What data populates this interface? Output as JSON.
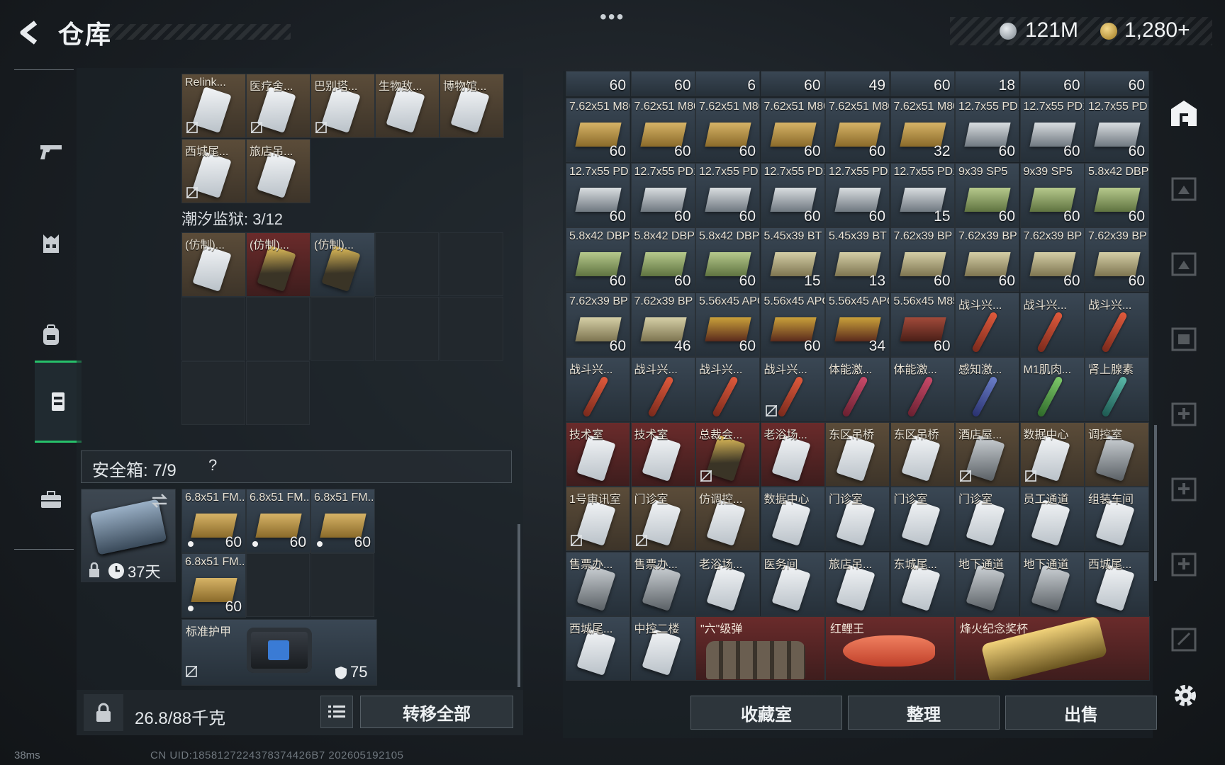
{
  "header": {
    "title": "仓库",
    "currency_silver": "121M",
    "currency_gold": "1,280+"
  },
  "nav": {
    "items": [
      "weapon",
      "vest",
      "backpack",
      "storage",
      "case"
    ]
  },
  "left": {
    "row1": [
      {
        "label": "Relink...",
        "type": "keycard",
        "color": "tan",
        "nobind": true
      },
      {
        "label": "医疗舍...",
        "type": "keycard",
        "color": "tan",
        "nobind": true
      },
      {
        "label": "巴别塔...",
        "type": "keycard",
        "color": "tan",
        "nobind": true
      },
      {
        "label": "生物敌...",
        "type": "keycard",
        "color": "tan"
      },
      {
        "label": "博物馆...",
        "type": "keycard",
        "color": "tan"
      }
    ],
    "row2": [
      {
        "label": "西城尾...",
        "type": "keycard",
        "color": "tan",
        "nobind": true
      },
      {
        "label": "旅店吊...",
        "type": "keycard",
        "color": "tan"
      }
    ],
    "prison_label": "潮汐监狱: 3/12",
    "prison": [
      {
        "label": "(仿制)...",
        "type": "keycard",
        "color": "tan"
      },
      {
        "label": "(仿制)...",
        "type": "keycard",
        "color": "red",
        "variant": "gold"
      },
      {
        "label": "(仿制)...",
        "type": "keycard",
        "color": "blue",
        "variant": "gold"
      }
    ],
    "safe_label": "安全箱: 7/9",
    "safe_help": "?",
    "safe_days": "37天",
    "safe_items": [
      {
        "label": "6.8x51 FM...",
        "count": "60"
      },
      {
        "label": "6.8x51 FM...",
        "count": "60"
      },
      {
        "label": "6.8x51 FM...",
        "count": "60"
      },
      {
        "label": "6.8x51 FM...",
        "count": "60"
      }
    ],
    "armor_label": "标准护甲",
    "armor_value": "75",
    "weight": "26.8/88千克",
    "transfer_all": "转移全部"
  },
  "right": {
    "top_counts": [
      "60",
      "60",
      "6",
      "60",
      "49",
      "60",
      "18",
      "60",
      "60"
    ],
    "rows": [
      [
        {
          "label": "7.62x51 M80",
          "count": "60",
          "type": "ammo",
          "color": "blue",
          "box": "gold"
        },
        {
          "label": "7.62x51 M80",
          "count": "60",
          "type": "ammo",
          "color": "blue",
          "box": "gold"
        },
        {
          "label": "7.62x51 M80",
          "count": "60",
          "type": "ammo",
          "color": "blue",
          "box": "gold"
        },
        {
          "label": "7.62x51 M80",
          "count": "60",
          "type": "ammo",
          "color": "blue",
          "box": "gold"
        },
        {
          "label": "7.62x51 M80",
          "count": "60",
          "type": "ammo",
          "color": "blue",
          "box": "gold"
        },
        {
          "label": "7.62x51 M80",
          "count": "32",
          "type": "ammo",
          "color": "blue",
          "box": "gold"
        },
        {
          "label": "12.7x55 PD12",
          "count": "60",
          "type": "ammo",
          "color": "blue",
          "box": "silver"
        },
        {
          "label": "12.7x55 PD12",
          "count": "60",
          "type": "ammo",
          "color": "blue",
          "box": "silver"
        },
        {
          "label": "12.7x55 PD12",
          "count": "60",
          "type": "ammo",
          "color": "blue",
          "box": "silver"
        }
      ],
      [
        {
          "label": "12.7x55 PD12",
          "count": "60",
          "type": "ammo",
          "color": "blue",
          "box": "silver"
        },
        {
          "label": "12.7x55 PD12",
          "count": "60",
          "type": "ammo",
          "color": "blue",
          "box": "silver"
        },
        {
          "label": "12.7x55 PD12",
          "count": "60",
          "type": "ammo",
          "color": "blue",
          "box": "silver"
        },
        {
          "label": "12.7x55 PD12",
          "count": "60",
          "type": "ammo",
          "color": "blue",
          "box": "silver"
        },
        {
          "label": "12.7x55 PD12",
          "count": "60",
          "type": "ammo",
          "color": "blue",
          "box": "silver"
        },
        {
          "label": "12.7x55 PD12",
          "count": "15",
          "type": "ammo",
          "color": "blue",
          "box": "silver"
        },
        {
          "label": "9x39 SP5",
          "count": "60",
          "type": "ammo",
          "color": "blue",
          "box": "green"
        },
        {
          "label": "9x39 SP5",
          "count": "60",
          "type": "ammo",
          "color": "blue",
          "box": "green"
        },
        {
          "label": "5.8x42 DBP10",
          "count": "60",
          "type": "ammo",
          "color": "blue",
          "box": "green"
        }
      ],
      [
        {
          "label": "5.8x42 DBP10",
          "count": "60",
          "type": "ammo",
          "color": "blue",
          "box": "green"
        },
        {
          "label": "5.8x42 DBP10",
          "count": "60",
          "type": "ammo",
          "color": "blue",
          "box": "green"
        },
        {
          "label": "5.8x42 DBP10",
          "count": "60",
          "type": "ammo",
          "color": "blue",
          "box": "green"
        },
        {
          "label": "5.45x39 BT",
          "count": "15",
          "type": "ammo",
          "color": "blue",
          "box": "khaki"
        },
        {
          "label": "5.45x39 BT",
          "count": "13",
          "type": "ammo",
          "color": "blue",
          "box": "khaki"
        },
        {
          "label": "7.62x39 BP",
          "count": "60",
          "type": "ammo",
          "color": "blue",
          "box": "khaki"
        },
        {
          "label": "7.62x39 BP",
          "count": "60",
          "type": "ammo",
          "color": "blue",
          "box": "khaki"
        },
        {
          "label": "7.62x39 BP",
          "count": "60",
          "type": "ammo",
          "color": "blue",
          "box": "khaki"
        },
        {
          "label": "7.62x39 BP",
          "count": "60",
          "type": "ammo",
          "color": "blue",
          "box": "khaki"
        }
      ],
      [
        {
          "label": "7.62x39 BP",
          "count": "60",
          "type": "ammo",
          "color": "blue",
          "box": "khaki"
        },
        {
          "label": "7.62x39 BP",
          "count": "46",
          "type": "ammo",
          "color": "blue",
          "box": "khaki"
        },
        {
          "label": "5.56x45 APC",
          "count": "60",
          "type": "ammo",
          "color": "blue",
          "box": "apc"
        },
        {
          "label": "5.56x45 APC",
          "count": "60",
          "type": "ammo",
          "color": "blue",
          "box": "apc"
        },
        {
          "label": "5.56x45 APC",
          "count": "34",
          "type": "ammo",
          "color": "blue",
          "box": "apc"
        },
        {
          "label": "5.56x45 M855A1",
          "count": "60",
          "type": "ammo",
          "color": "blue",
          "box": "red"
        },
        {
          "label": "战斗兴...",
          "count": "",
          "type": "injector",
          "color": "blue",
          "inj": ""
        },
        {
          "label": "战斗兴...",
          "count": "",
          "type": "injector",
          "color": "blue",
          "inj": ""
        },
        {
          "label": "战斗兴...",
          "count": "",
          "type": "injector",
          "color": "blue",
          "inj": ""
        }
      ],
      [
        {
          "label": "战斗兴...",
          "count": "",
          "type": "injector",
          "color": "blue",
          "inj": ""
        },
        {
          "label": "战斗兴...",
          "count": "",
          "type": "injector",
          "color": "blue",
          "inj": ""
        },
        {
          "label": "战斗兴...",
          "count": "",
          "type": "injector",
          "color": "blue",
          "inj": ""
        },
        {
          "label": "战斗兴...",
          "count": "",
          "type": "injector",
          "color": "blue",
          "inj": "",
          "nobind": true
        },
        {
          "label": "体能激...",
          "count": "",
          "type": "injector",
          "color": "blue",
          "inj": "pink"
        },
        {
          "label": "体能激...",
          "count": "",
          "type": "injector",
          "color": "blue",
          "inj": "pink"
        },
        {
          "label": "感知激...",
          "count": "",
          "type": "injector",
          "color": "blue",
          "inj": "blue"
        },
        {
          "label": "M1肌肉...",
          "count": "",
          "type": "injector",
          "color": "blue",
          "inj": "green"
        },
        {
          "label": "肾上腺素",
          "count": "",
          "type": "injector",
          "color": "blue",
          "inj": "teal"
        }
      ],
      [
        {
          "label": "技术室",
          "type": "keycard",
          "color": "red"
        },
        {
          "label": "技术室",
          "type": "keycard",
          "color": "red"
        },
        {
          "label": "总裁会...",
          "type": "keycard",
          "color": "red",
          "variant": "gold",
          "nobind": true
        },
        {
          "label": "老浴场...",
          "type": "keycard",
          "color": "red"
        },
        {
          "label": "东区吊桥",
          "type": "keycard",
          "color": "tan"
        },
        {
          "label": "东区吊桥",
          "type": "keycard",
          "color": "tan"
        },
        {
          "label": "酒店屋...",
          "type": "keycard",
          "color": "tan",
          "variant": "dark",
          "nobind": true
        },
        {
          "label": "数据中心",
          "type": "keycard",
          "color": "tan",
          "nobind": true
        },
        {
          "label": "调控室",
          "type": "keycard",
          "color": "tan",
          "variant": "dark"
        }
      ],
      [
        {
          "label": "1号审讯室",
          "type": "keycard",
          "color": "tan",
          "nobind": true
        },
        {
          "label": "门诊室",
          "type": "keycard",
          "color": "tan",
          "nobind": true
        },
        {
          "label": "仿调控...",
          "type": "keycard",
          "color": "tan"
        },
        {
          "label": "数据中心",
          "type": "keycard",
          "color": "blue"
        },
        {
          "label": "门诊室",
          "type": "keycard",
          "color": "blue"
        },
        {
          "label": "门诊室",
          "type": "keycard",
          "color": "blue"
        },
        {
          "label": "门诊室",
          "type": "keycard",
          "color": "blue"
        },
        {
          "label": "员工通道",
          "type": "keycard",
          "color": "blue"
        },
        {
          "label": "组装车间",
          "type": "keycard",
          "color": "blue"
        }
      ],
      [
        {
          "label": "售票办...",
          "type": "keycard",
          "color": "blue",
          "variant": "dark"
        },
        {
          "label": "售票办...",
          "type": "keycard",
          "color": "blue",
          "variant": "dark"
        },
        {
          "label": "老浴场...",
          "type": "keycard",
          "color": "blue"
        },
        {
          "label": "医务间",
          "type": "keycard",
          "color": "blue"
        },
        {
          "label": "旅店吊...",
          "type": "keycard",
          "color": "blue"
        },
        {
          "label": "东城尾...",
          "type": "keycard",
          "color": "blue"
        },
        {
          "label": "地下通道",
          "type": "keycard",
          "color": "blue",
          "variant": "dark"
        },
        {
          "label": "地下通道",
          "type": "keycard",
          "color": "blue",
          "variant": "dark"
        },
        {
          "label": "西城尾...",
          "type": "keycard",
          "color": "blue"
        }
      ]
    ],
    "last_row": {
      "small": [
        {
          "label": "西城尾...",
          "type": "keycard",
          "color": "blue"
        },
        {
          "label": "中控二楼",
          "type": "keycard",
          "color": "blue"
        }
      ],
      "big": [
        {
          "label": "\"六\"级弹",
          "kind": "bullets"
        },
        {
          "label": "红鲤王",
          "kind": "fish"
        },
        {
          "label": "烽火纪念奖杯",
          "kind": "artifact"
        }
      ]
    },
    "buttons": {
      "collect": "收藏室",
      "sort": "整理",
      "sell": "出售"
    }
  },
  "status": {
    "ping": "38ms",
    "uid": "CN UID:1858127224378374426B7 202605192105"
  }
}
